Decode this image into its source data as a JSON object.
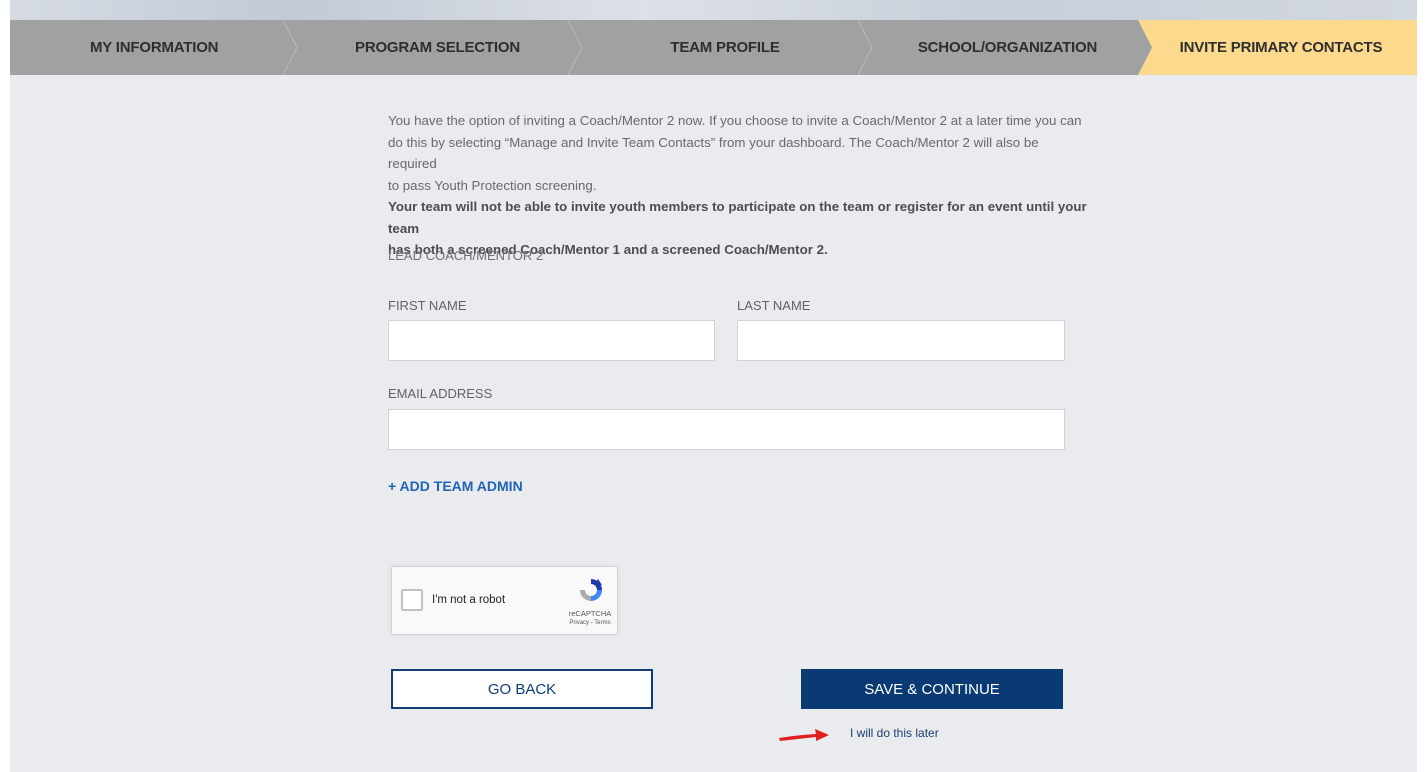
{
  "steps": [
    {
      "label": "MY INFORMATION"
    },
    {
      "label": "PROGRAM SELECTION"
    },
    {
      "label": "TEAM PROFILE"
    },
    {
      "label": "SCHOOL/ORGANIZATION"
    },
    {
      "label": "INVITE PRIMARY CONTACTS",
      "active": true
    }
  ],
  "intro": {
    "line1": "You have the option of inviting  a Coach/Mentor 2 now.  If you choose to invite a Coach/Mentor 2 at a later time you can",
    "line2": "do this by selecting “Manage and Invite Team Contacts” from your dashboard.  The Coach/Mentor 2 will also be required",
    "line3": "to pass Youth Protection screening.",
    "bold1": "Your team will not be able to invite youth members to participate on the team or register for an event until your team",
    "bold2": "has both a screened Coach/Mentor 1 and a screened Coach/Mentor 2."
  },
  "form": {
    "section_label": "LEAD COACH/MENTOR 2",
    "first_name_label": "FIRST NAME",
    "last_name_label": "LAST NAME",
    "email_label": "EMAIL ADDRESS",
    "first_name_value": "",
    "last_name_value": "",
    "email_value": "",
    "add_admin": "+ ADD TEAM ADMIN"
  },
  "recaptcha": {
    "label": "I'm not a robot",
    "brand": "reCAPTCHA",
    "terms": "Privacy - Terms"
  },
  "actions": {
    "back": "GO BACK",
    "save": "SAVE & CONTINUE",
    "later": "I will do this later"
  },
  "colors": {
    "active_step": "#fcd98d",
    "step_bar": "#a0a1a3",
    "primary": "#0a3a73",
    "link": "#1f64b5",
    "arrow": "#e0201c"
  }
}
